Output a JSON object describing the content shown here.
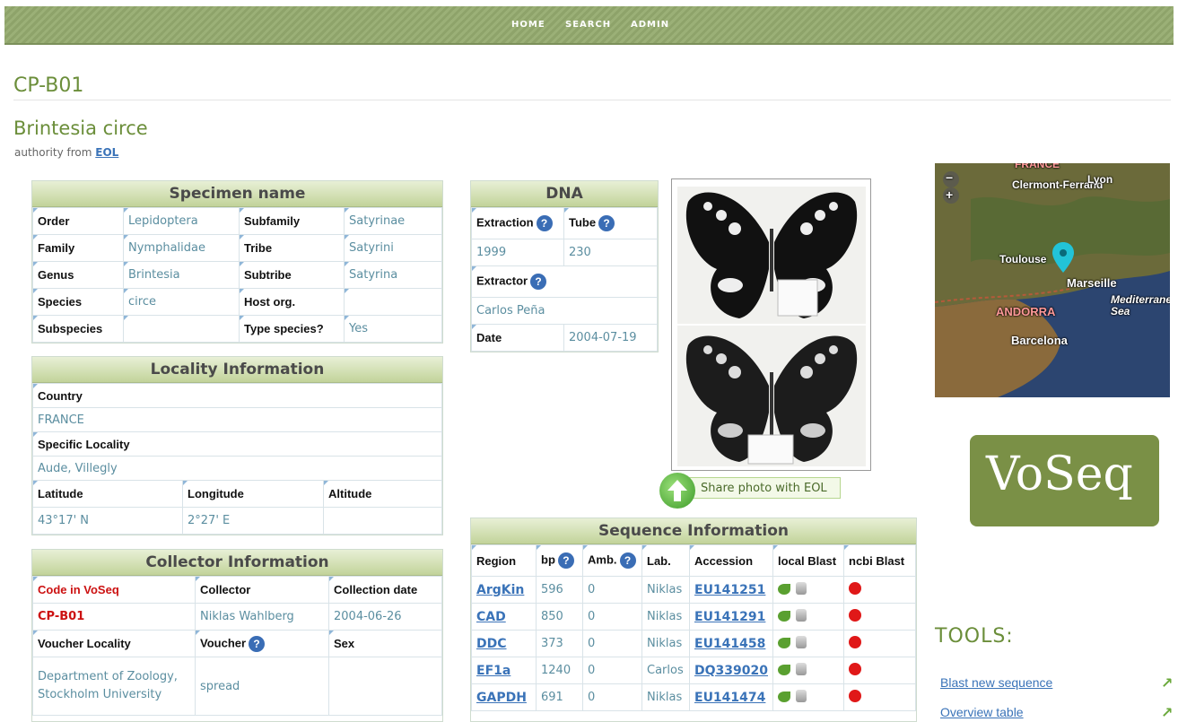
{
  "nav": {
    "home": "HOME",
    "search": "SEARCH",
    "admin": "ADMIN"
  },
  "page": {
    "code": "CP-B01",
    "species_title": "Brintesia circe",
    "authority_prefix": "authority from",
    "authority_link": "EOL"
  },
  "specimen": {
    "title": "Specimen name",
    "rows": [
      {
        "l1": "Order",
        "v1": "Lepidoptera",
        "l2": "Subfamily",
        "v2": "Satyrinae"
      },
      {
        "l1": "Family",
        "v1": "Nymphalidae",
        "l2": "Tribe",
        "v2": "Satyrini"
      },
      {
        "l1": "Genus",
        "v1": "Brintesia",
        "l2": "Subtribe",
        "v2": "Satyrina"
      },
      {
        "l1": "Species",
        "v1": "circe",
        "l2": "Host org.",
        "v2": ""
      },
      {
        "l1": "Subspecies",
        "v1": "",
        "l2": "Type species?",
        "v2": "Yes"
      }
    ]
  },
  "locality": {
    "title": "Locality Information",
    "country_label": "Country",
    "country": "FRANCE",
    "specific_label": "Specific Locality",
    "specific": "Aude, Villegly",
    "lat_label": "Latitude",
    "lat": "43°17' N",
    "lon_label": "Longitude",
    "lon": "2°27' E",
    "alt_label": "Altitude",
    "alt": ""
  },
  "collector": {
    "title": "Collector Information",
    "code_label": "Code in VoSeq",
    "code": "CP-B01",
    "collector_label": "Collector",
    "collector": "Niklas Wahlberg",
    "date_label": "Collection date",
    "date": "2004-06-26",
    "voucher_loc_label": "Voucher Locality",
    "voucher_loc": "Department of Zoology, Stockholm University",
    "voucher_label": "Voucher",
    "voucher": "spread",
    "sex_label": "Sex",
    "sex": ""
  },
  "dna": {
    "title": "DNA",
    "extraction_label": "Extraction",
    "extraction": "1999",
    "tube_label": "Tube",
    "tube": "230",
    "extractor_label": "Extractor",
    "extractor": "Carlos Peña",
    "date_label": "Date",
    "date": "2004-07-19"
  },
  "share": {
    "label": "Share photo with EOL"
  },
  "sequence": {
    "title": "Sequence Information",
    "headers": {
      "region": "Region",
      "bp": "bp",
      "amb": "Amb.",
      "lab": "Lab.",
      "accession": "Accession",
      "local": "local Blast",
      "ncbi": "ncbi Blast"
    },
    "rows": [
      {
        "region": "ArgKin",
        "bp": "596",
        "amb": "0",
        "lab": "Niklas",
        "acc": "EU141251"
      },
      {
        "region": "CAD",
        "bp": "850",
        "amb": "0",
        "lab": "Niklas",
        "acc": "EU141291"
      },
      {
        "region": "DDC",
        "bp": "373",
        "amb": "0",
        "lab": "Niklas",
        "acc": "EU141458"
      },
      {
        "region": "EF1a",
        "bp": "1240",
        "amb": "0",
        "lab": "Carlos",
        "acc": "DQ339020"
      },
      {
        "region": "GAPDH",
        "bp": "691",
        "amb": "0",
        "lab": "Niklas",
        "acc": "EU141474"
      }
    ]
  },
  "map": {
    "labels": {
      "lyon": "Lyon",
      "clermont": "Clermont-Ferrand",
      "toulouse": "Toulouse",
      "marseille": "Marseille",
      "andorra": "ANDORRA",
      "barcelona": "Barcelona",
      "med": "Mediterranean Sea",
      "france": "FRANCE"
    }
  },
  "logo": {
    "text": "VoSeq"
  },
  "tools": {
    "title": "TOOLS:",
    "items": [
      "Blast new sequence",
      "Overview table"
    ]
  }
}
